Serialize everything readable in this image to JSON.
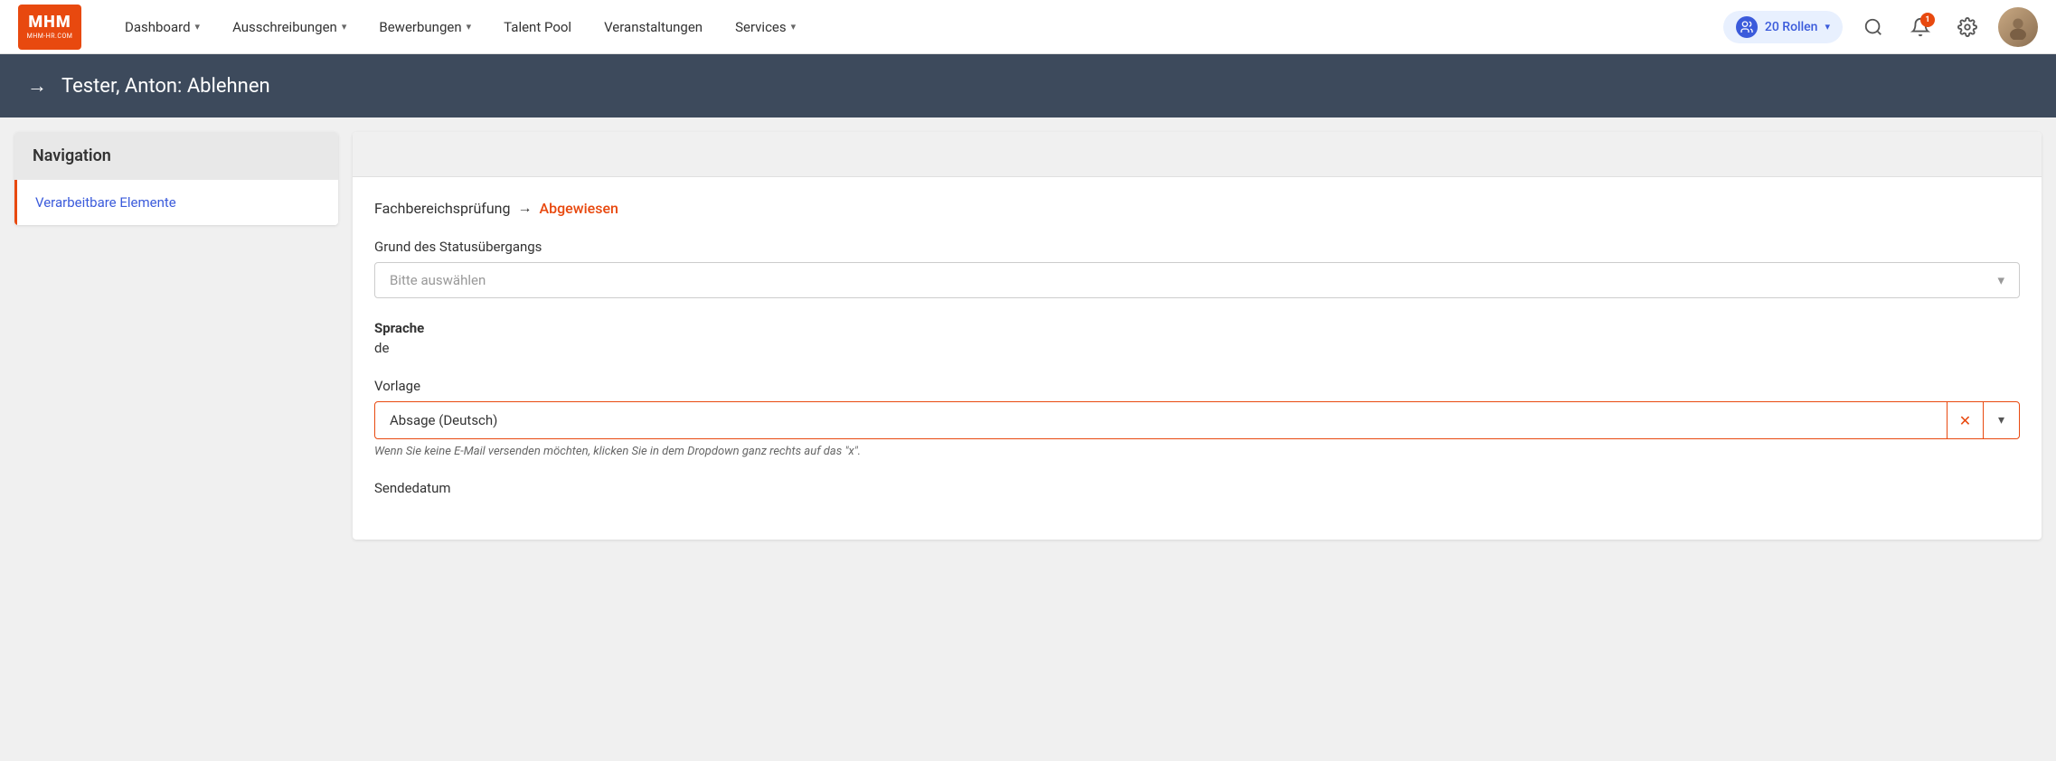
{
  "logo": {
    "text": "MHM",
    "sub": "MHM-HR.COM"
  },
  "nav": {
    "items": [
      {
        "label": "Dashboard",
        "has_dropdown": true
      },
      {
        "label": "Ausschreibungen",
        "has_dropdown": true
      },
      {
        "label": "Bewerbungen",
        "has_dropdown": true
      },
      {
        "label": "Talent Pool",
        "has_dropdown": false
      },
      {
        "label": "Veranstaltungen",
        "has_dropdown": false
      },
      {
        "label": "Services",
        "has_dropdown": true
      }
    ],
    "roles_label": "20 Rollen",
    "notification_count": "1"
  },
  "page_header": {
    "title": "Tester, Anton: Ablehnen",
    "icon": "→"
  },
  "sidebar": {
    "heading": "Navigation",
    "nav_item": "Verarbeitbare Elemente"
  },
  "content": {
    "breadcrumb_text": "Fachbereichsprüfung",
    "breadcrumb_arrow": "→",
    "breadcrumb_status": "Abgewiesen",
    "status_grund_label": "Grund des Statusübergangs",
    "status_grund_placeholder": "Bitte auswählen",
    "sprache_label": "Sprache",
    "sprache_value": "de",
    "vorlage_label": "Vorlage",
    "vorlage_value": "Absage (Deutsch)",
    "hint_text": "Wenn Sie keine E-Mail versenden möchten, klicken Sie in dem Dropdown ganz rechts auf das \"x\".",
    "sendedatum_label": "Sendedatum"
  }
}
